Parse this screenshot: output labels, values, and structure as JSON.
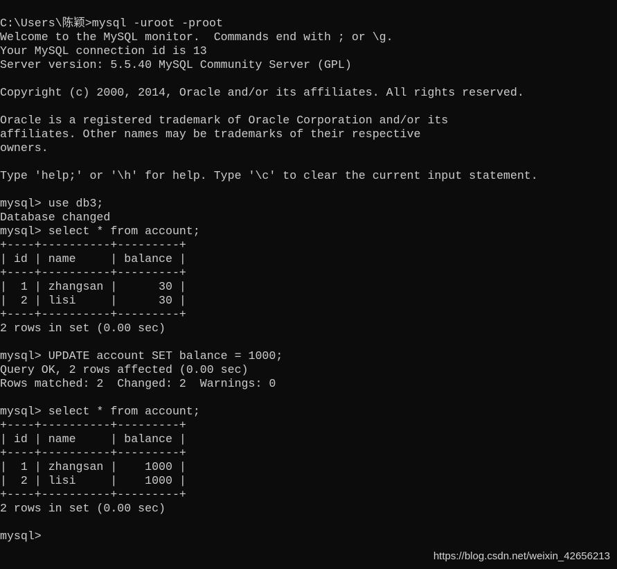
{
  "terminal": {
    "lines": [
      "",
      "",
      "C:\\Users\\陈颖>mysql -uroot -proot",
      "Welcome to the MySQL monitor.  Commands end with ; or \\g.",
      "Your MySQL connection id is 13",
      "Server version: 5.5.40 MySQL Community Server (GPL)",
      "",
      "Copyright (c) 2000, 2014, Oracle and/or its affiliates. All rights reserved.",
      "",
      "Oracle is a registered trademark of Oracle Corporation and/or its",
      "affiliates. Other names may be trademarks of their respective",
      "owners.",
      "",
      "Type 'help;' or '\\h' for help. Type '\\c' to clear the current input statement.",
      "",
      "mysql> use db3;",
      "Database changed",
      "mysql> select * from account;",
      "+----+----------+---------+",
      "| id | name     | balance |",
      "+----+----------+---------+",
      "|  1 | zhangsan |      30 |",
      "|  2 | lisi     |      30 |",
      "+----+----------+---------+",
      "2 rows in set (0.00 sec)",
      "",
      "mysql> UPDATE account SET balance = 1000;",
      "Query OK, 2 rows affected (0.00 sec)",
      "Rows matched: 2  Changed: 2  Warnings: 0",
      "",
      "mysql> select * from account;",
      "+----+----------+---------+",
      "| id | name     | balance |",
      "+----+----------+---------+",
      "|  1 | zhangsan |    1000 |",
      "|  2 | lisi     |    1000 |",
      "+----+----------+---------+",
      "2 rows in set (0.00 sec)",
      "",
      "mysql> "
    ]
  },
  "watermark": "https://blog.csdn.net/weixin_42656213",
  "colors": {
    "background": "#0c0c0c",
    "text": "#cccccc"
  }
}
